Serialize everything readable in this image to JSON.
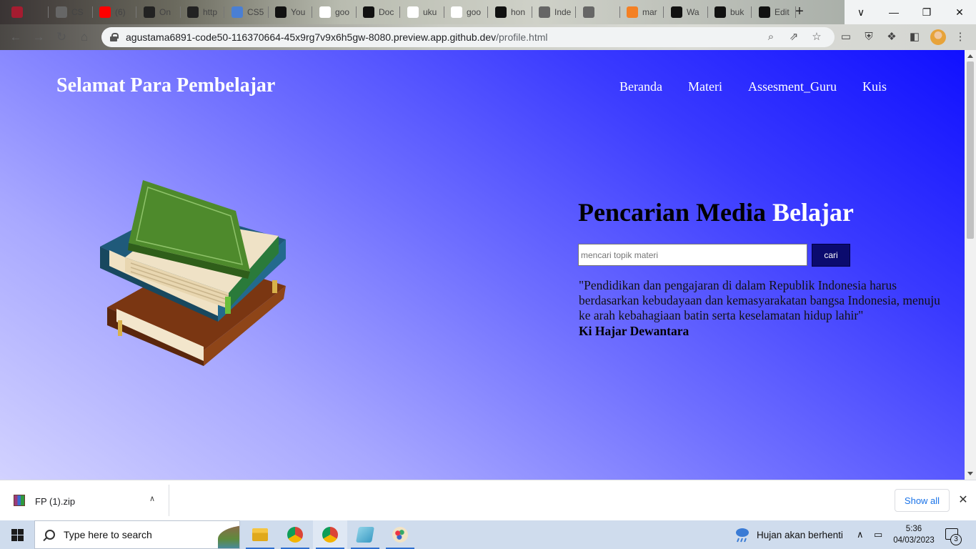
{
  "browser": {
    "tabs": [
      {
        "label": "",
        "icon": "harvard-favicon-icon",
        "color": "#a51c30"
      },
      {
        "label": "CS",
        "icon": "globe-favicon-icon",
        "color": "#666666"
      },
      {
        "label": "(6)",
        "icon": "youtube-favicon-icon",
        "color": "#ff0000"
      },
      {
        "label": "On",
        "icon": "d-favicon-icon",
        "color": "#222222"
      },
      {
        "label": "http",
        "icon": "d-favicon-icon",
        "color": "#222222"
      },
      {
        "label": "CS5",
        "icon": "chart-favicon-icon",
        "color": "#4a7fd4"
      },
      {
        "label": "You",
        "icon": "github-favicon-icon",
        "color": "#111111"
      },
      {
        "label": "goo",
        "icon": "google-favicon-icon",
        "color": "#ffffff"
      },
      {
        "label": "Doc",
        "icon": "github-favicon-icon",
        "color": "#111111"
      },
      {
        "label": "uku",
        "icon": "google-favicon-icon",
        "color": "#ffffff"
      },
      {
        "label": "goo",
        "icon": "google-favicon-icon",
        "color": "#ffffff"
      },
      {
        "label": "hon",
        "icon": "github-favicon-icon",
        "color": "#111111"
      },
      {
        "label": "Inde",
        "icon": "globe-favicon-icon",
        "color": "#666666"
      },
      {
        "label": "",
        "icon": "globe-favicon-icon",
        "color": "#666666"
      },
      {
        "label": "mar",
        "icon": "stackoverflow-favicon-icon",
        "color": "#f48024"
      },
      {
        "label": "Wa",
        "icon": "github-favicon-icon",
        "color": "#111111"
      },
      {
        "label": "buk",
        "icon": "github-favicon-icon",
        "color": "#111111"
      },
      {
        "label": "Edit",
        "icon": "github-favicon-icon",
        "color": "#111111"
      }
    ],
    "url_host": "agustama6891-code50-116370664-45x9rg7v9x6h5gw-8080.preview.app.github.dev",
    "url_path": "/profile.html"
  },
  "page": {
    "site_title": "Selamat Para Pembelajar",
    "nav": [
      "Beranda",
      "Materi",
      "Assesment_Guru",
      "Kuis"
    ],
    "hero_title_dark": "Pencarian Media",
    "hero_title_light": "Belajar",
    "search_placeholder": "mencari topik materi",
    "search_button": "cari",
    "quote": "\"Pendidikan dan pengajaran di dalam Republik Indonesia harus berdasarkan kebudayaan dan kemasyarakatan bangsa Indonesia, menuju ke arah kebahagiaan batin serta keselamatan hidup lahir\"",
    "quote_author": "Ki Hajar Dewantara",
    "image": "stack-of-books-illustration"
  },
  "downloads": {
    "file_name": "FP (1).zip",
    "show_all": "Show all"
  },
  "taskbar": {
    "search_placeholder": "Type here to search",
    "weather": "Hujan akan berhenti",
    "time": "5:36",
    "date": "04/03/2023",
    "notification_count": "3"
  }
}
